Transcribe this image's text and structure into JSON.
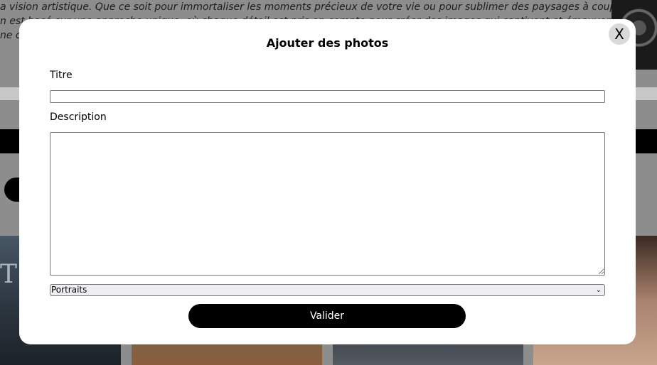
{
  "background": {
    "intro_lines": [
      "a vision artistique. Que ce soit pour immortaliser les moments précieux de votre vie ou pour sublimer des paysages à couper le",
      "n est basé sur une approche unique, où chaque détail est pris en compte pour créer des images qui captivent et émeuvent. Que ce",
      "ne co"
    ]
  },
  "modal": {
    "title": "Ajouter des photos",
    "close_label": "X",
    "title_field": {
      "label": "Titre",
      "value": "",
      "placeholder": ""
    },
    "description_field": {
      "label": "Description",
      "value": "",
      "placeholder": ""
    },
    "category_select": {
      "selected": "Portraits",
      "options": [
        "Portraits"
      ]
    },
    "submit_label": "Valider"
  },
  "icons": {
    "select_arrow": "chevron-down-icon"
  },
  "colors": {
    "overlay": "#8d8d8d",
    "modal_bg": "#ffffff",
    "button_bg": "#000000",
    "button_text": "#ffffff"
  }
}
